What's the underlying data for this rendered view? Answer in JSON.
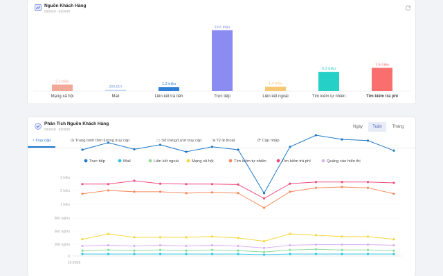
{
  "overview": {
    "title": "Nguồn Khách Hàng",
    "date_range": "03/2019 - 02/2020",
    "chart_data": {
      "type": "bar",
      "categories": [
        "Mạng xã hội",
        "Mail",
        "Liên kết trả tiền",
        "Trực tiếp",
        "Liên kết ngoài",
        "Tìm kiếm tự nhiên",
        "Tìm kiếm trả phí"
      ],
      "values": [
        2.1,
        0.309807,
        1.3,
        19.6,
        1.4,
        6.2,
        7.5
      ],
      "value_labels": [
        "2.1 triệu",
        "309,807",
        "1.3 triệu",
        "19.6 triệu",
        "1.4 triệu",
        "6.2 triệu",
        "7.5 triệu"
      ],
      "colors": [
        "#f2a998",
        "#c3d7f7",
        "#2f7fd8",
        "#8b8cf2",
        "#f7c873",
        "#25d0c6",
        "#f96f6e"
      ],
      "ylim": [
        0,
        20
      ]
    }
  },
  "analysis": {
    "title": "Phân Tích Nguồn Khách Hàng",
    "date_range": "03/2019 - 02/2020",
    "period_buttons": [
      "Ngày",
      "Tuần",
      "Tháng"
    ],
    "active_period": "Tuần",
    "tabs": [
      "Truy cập",
      "Trung bình thời lượng truy cập",
      "Số trang/Lượt truy cập",
      "Tỷ lệ thoát",
      "Cập nhập"
    ],
    "tab_icons": [
      "pie-icon",
      "clock-icon",
      "page-icon",
      "exit-icon",
      "refresh-icon"
    ],
    "chart_data": {
      "type": "line",
      "x": [
        "12-2019",
        "",
        "",
        "",
        "",
        "",
        "",
        "",
        "",
        "",
        "",
        "",
        "",
        ""
      ],
      "y_ticks": [
        "0",
        "300 nghìn",
        "600 nghìn",
        "800 nghìn",
        "1 triệu",
        "2 triệu",
        "2 triệu"
      ],
      "series": [
        {
          "name": "Trực tiếp",
          "color": "#1f78c8",
          "values": [
            1.95,
            2.12,
            1.96,
            2.07,
            1.9,
            2.02,
            1.95,
            0.94,
            2.02,
            2.3,
            2.2,
            2.17,
            1.93
          ]
        },
        {
          "name": "Mail",
          "color": "#28c4e0",
          "values": [
            0.03,
            0.03,
            0.03,
            0.03,
            0.03,
            0.03,
            0.03,
            0.02,
            0.03,
            0.03,
            0.03,
            0.03,
            0.03
          ]
        },
        {
          "name": "Liên kết ngoài",
          "color": "#8fdc9a",
          "values": [
            0.08,
            0.09,
            0.08,
            0.09,
            0.08,
            0.09,
            0.08,
            0.06,
            0.09,
            0.1,
            0.09,
            0.09,
            0.08
          ]
        },
        {
          "name": "Mạng xã hội",
          "color": "#f5d63d",
          "values": [
            0.25,
            0.33,
            0.28,
            0.28,
            0.28,
            0.29,
            0.27,
            0.22,
            0.33,
            0.31,
            0.29,
            0.29,
            0.25
          ]
        },
        {
          "name": "Tìm kiếm tự nhiên",
          "color": "#f7895c",
          "values": [
            0.93,
            0.98,
            0.96,
            0.96,
            0.94,
            0.95,
            0.94,
            0.72,
            0.96,
            1.03,
            1.05,
            1.03,
            0.93
          ]
        },
        {
          "name": "Tìm kiếm trả phí",
          "color": "#ee4c7c",
          "values": [
            1.12,
            1.12,
            1.2,
            1.13,
            1.12,
            1.12,
            1.11,
            0.86,
            1.13,
            1.17,
            1.17,
            1.17,
            1.15
          ]
        },
        {
          "name": "Quảng cáo hiển thị",
          "color": "#d9b3f0",
          "values": [
            0.15,
            0.16,
            0.15,
            0.16,
            0.15,
            0.16,
            0.15,
            0.12,
            0.16,
            0.17,
            0.17,
            0.17,
            0.16
          ]
        }
      ],
      "grid": true,
      "legend_position": "top-center"
    }
  }
}
